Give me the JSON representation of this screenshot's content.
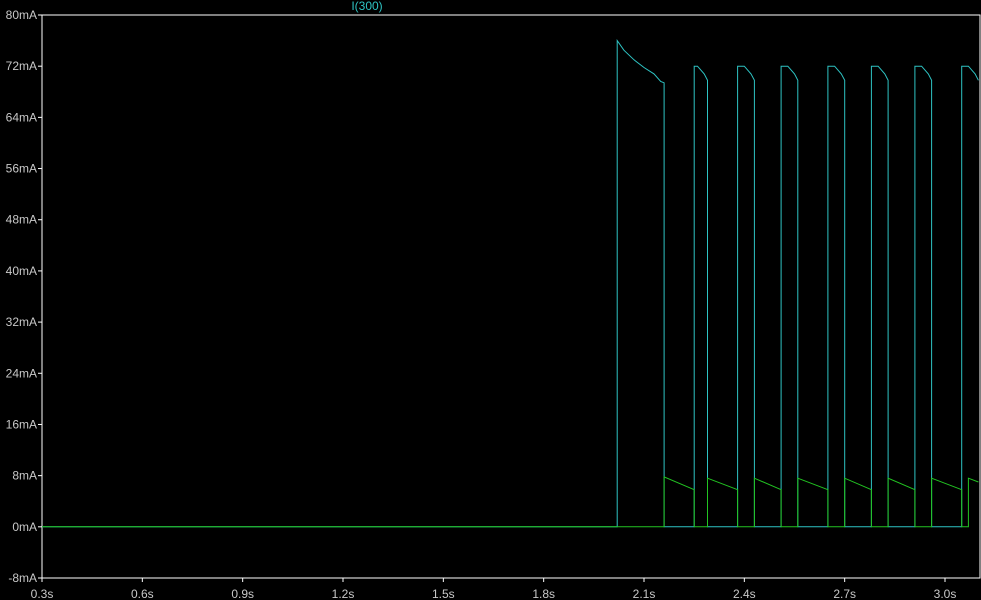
{
  "chart_data": {
    "type": "line",
    "title": "",
    "xlabel": "",
    "ylabel": "",
    "xlim": [
      0.3,
      3.1
    ],
    "ylim": [
      -8,
      80
    ],
    "x_ticks": [
      0.3,
      0.6,
      0.9,
      1.2,
      1.5,
      1.8,
      2.1,
      2.4,
      2.7,
      3.0
    ],
    "x_tick_labels": [
      "0.3s",
      "0.6s",
      "0.9s",
      "1.2s",
      "1.5s",
      "1.8s",
      "2.1s",
      "2.4s",
      "2.7s",
      "3.0s"
    ],
    "y_ticks": [
      -8,
      0,
      8,
      16,
      24,
      32,
      40,
      48,
      56,
      64,
      72,
      80
    ],
    "y_tick_labels": [
      "-8mA",
      "0mA",
      "8mA",
      "16mA",
      "24mA",
      "32mA",
      "40mA",
      "48mA",
      "56mA",
      "64mA",
      "72mA",
      "80mA"
    ],
    "grid": false,
    "legend": "top-center",
    "series": [
      {
        "name": "I(300)",
        "color": "#2ec4c4",
        "x": [
          0.3,
          2.02,
          2.02,
          2.04,
          2.07,
          2.1,
          2.13,
          2.15,
          2.16,
          2.16,
          2.25,
          2.25,
          2.26,
          2.28,
          2.29,
          2.29,
          2.38,
          2.38,
          2.4,
          2.42,
          2.43,
          2.43,
          2.51,
          2.51,
          2.53,
          2.55,
          2.56,
          2.56,
          2.65,
          2.65,
          2.67,
          2.69,
          2.7,
          2.7,
          2.78,
          2.78,
          2.8,
          2.82,
          2.83,
          2.83,
          2.91,
          2.91,
          2.93,
          2.95,
          2.96,
          2.96,
          3.05,
          3.05,
          3.07,
          3.09,
          3.1
        ],
        "y": [
          0,
          0,
          76,
          74.5,
          73,
          71.8,
          70.8,
          69.6,
          69.4,
          0,
          0,
          72,
          72,
          70.8,
          69.8,
          0,
          0,
          72,
          72,
          70.8,
          69.8,
          0,
          0,
          72,
          72,
          70.8,
          69.8,
          0,
          0,
          72,
          72,
          70.8,
          69.8,
          0,
          0,
          72,
          72,
          70.8,
          69.8,
          0,
          0,
          72,
          72,
          70.8,
          69.8,
          0,
          0,
          72,
          72,
          70.8,
          69.8
        ]
      },
      {
        "name": "",
        "color": "#22c422",
        "x": [
          0.3,
          2.16,
          2.16,
          2.25,
          2.25,
          2.29,
          2.29,
          2.38,
          2.38,
          2.43,
          2.43,
          2.51,
          2.51,
          2.56,
          2.56,
          2.65,
          2.65,
          2.7,
          2.7,
          2.78,
          2.78,
          2.83,
          2.83,
          2.91,
          2.91,
          2.96,
          2.96,
          3.05,
          3.05,
          3.07,
          3.07,
          3.1
        ],
        "y": [
          0,
          0,
          7.8,
          5.8,
          0,
          0,
          7.6,
          5.8,
          0,
          0,
          7.6,
          5.8,
          0,
          0,
          7.6,
          5.8,
          0,
          0,
          7.6,
          5.8,
          0,
          0,
          7.6,
          5.8,
          0,
          0,
          7.6,
          5.8,
          0,
          0,
          7.6,
          7.0
        ]
      }
    ]
  }
}
